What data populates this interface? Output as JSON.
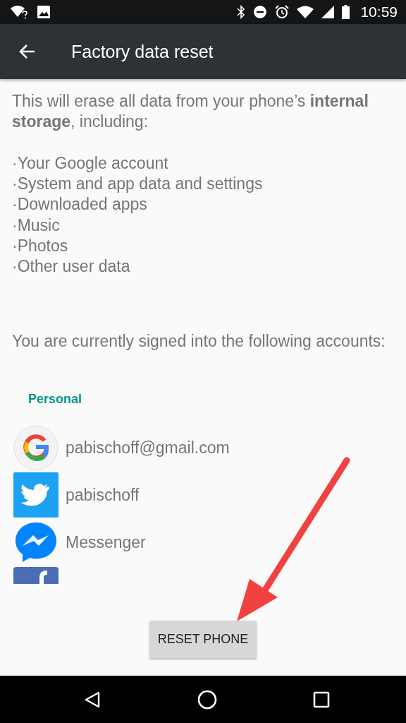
{
  "status_bar": {
    "time": "10:59"
  },
  "toolbar": {
    "title": "Factory data reset"
  },
  "intro": "This will erase all data from your phone’s **internal storage**, including:",
  "items": [
    "·Your Google account",
    "·System and app data and settings",
    "·Downloaded apps",
    "·Music",
    "·Photos",
    "·Other user data"
  ],
  "accounts_intro": "You are currently signed into the following accounts:",
  "section": "Personal",
  "accounts": [
    {
      "kind": "google",
      "name": "pabischoff@gmail.com"
    },
    {
      "kind": "twitter",
      "name": "pabischoff"
    },
    {
      "kind": "messenger",
      "name": "Messenger"
    },
    {
      "kind": "facebook"
    }
  ],
  "button": "RESET PHONE"
}
